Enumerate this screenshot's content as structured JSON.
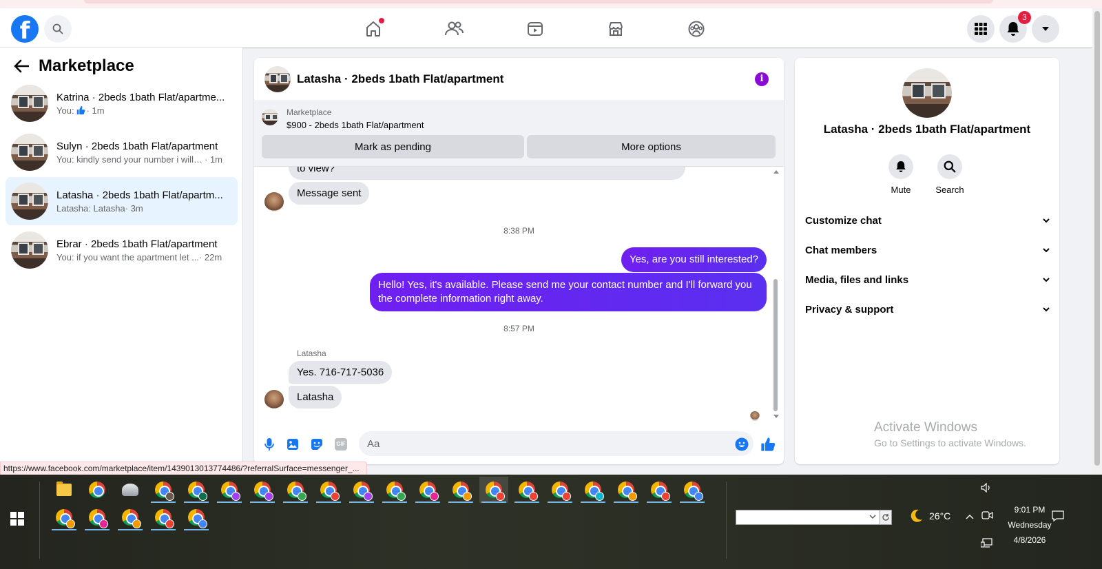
{
  "browser": {
    "status_url": "https://www.facebook.com/marketplace/item/1439013013774486/?referralSurface=messenger_..."
  },
  "header": {
    "logo_letter": "f",
    "notification_count": "3"
  },
  "left_panel": {
    "title": "Marketplace",
    "conversations": [
      {
        "name": "Katrina · 2beds 1bath Flat/apartme...",
        "prefix": "You:",
        "preview": "",
        "time": "· 1m",
        "has_thumb": true,
        "active": false
      },
      {
        "name": "Sulyn · 2beds 1bath Flat/apartment",
        "prefix": "",
        "preview": "You: kindly send your number i will s...",
        "time": "· 1m",
        "active": false
      },
      {
        "name": "Latasha · 2beds 1bath Flat/apartm...",
        "prefix": "",
        "preview": "Latasha: Latasha",
        "time": "· 3m",
        "active": true
      },
      {
        "name": "Ebrar · 2beds 1bath Flat/apartment",
        "prefix": "",
        "preview": "You: if you want the apartment let ...",
        "time": "· 22m",
        "active": false
      }
    ]
  },
  "chat": {
    "title": "Latasha · 2beds 1bath Flat/apartment",
    "marketplace_label": "Marketplace",
    "listing": "$900 - 2beds 1bath Flat/apartment",
    "mark_pending_label": "Mark as pending",
    "more_options_label": "More options",
    "messages": {
      "partial_top": "to view?",
      "msg_sent": "Message sent",
      "ts1": "8:38 PM",
      "out1": "Yes, are you still interested?",
      "out2": "Hello! Yes, it's available. Please send me your contact number and I'll forward you the complete information right away.",
      "ts2": "8:57 PM",
      "sender": "Latasha",
      "in1": "Yes. 716-717-5036",
      "in2": "Latasha"
    },
    "composer_placeholder": "Aa",
    "gif_label": "GIF"
  },
  "right_panel": {
    "title": "Latasha · 2beds 1bath Flat/apartment",
    "mute_label": "Mute",
    "search_label": "Search",
    "sections": [
      "Customize chat",
      "Chat members",
      "Media, files and links",
      "Privacy & support"
    ],
    "activate_title": "Activate Windows",
    "activate_sub": "Go to Settings to activate Windows."
  },
  "taskbar": {
    "temperature": "26°C",
    "time": "9:01 PM",
    "day": "Wednesday",
    "date": "4/8/2026"
  },
  "colors": {
    "fb_blue": "#1877f2",
    "outgoing_bubble": "#6f1ff0",
    "active_conv": "#e7f3ff",
    "badge_red": "#e41e3f"
  }
}
